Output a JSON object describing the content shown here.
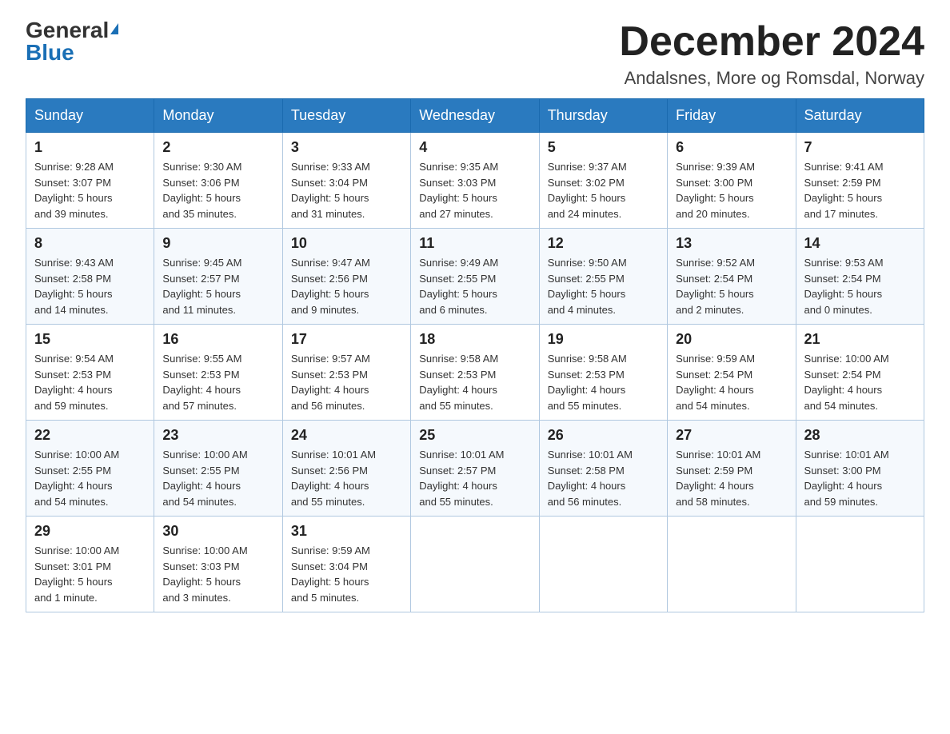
{
  "header": {
    "logo_line1": "General",
    "logo_line2": "Blue",
    "month_title": "December 2024",
    "location": "Andalsnes, More og Romsdal, Norway"
  },
  "weekdays": [
    "Sunday",
    "Monday",
    "Tuesday",
    "Wednesday",
    "Thursday",
    "Friday",
    "Saturday"
  ],
  "weeks": [
    [
      {
        "day": "1",
        "sunrise": "9:28 AM",
        "sunset": "3:07 PM",
        "daylight": "5 hours and 39 minutes."
      },
      {
        "day": "2",
        "sunrise": "9:30 AM",
        "sunset": "3:06 PM",
        "daylight": "5 hours and 35 minutes."
      },
      {
        "day": "3",
        "sunrise": "9:33 AM",
        "sunset": "3:04 PM",
        "daylight": "5 hours and 31 minutes."
      },
      {
        "day": "4",
        "sunrise": "9:35 AM",
        "sunset": "3:03 PM",
        "daylight": "5 hours and 27 minutes."
      },
      {
        "day": "5",
        "sunrise": "9:37 AM",
        "sunset": "3:02 PM",
        "daylight": "5 hours and 24 minutes."
      },
      {
        "day": "6",
        "sunrise": "9:39 AM",
        "sunset": "3:00 PM",
        "daylight": "5 hours and 20 minutes."
      },
      {
        "day": "7",
        "sunrise": "9:41 AM",
        "sunset": "2:59 PM",
        "daylight": "5 hours and 17 minutes."
      }
    ],
    [
      {
        "day": "8",
        "sunrise": "9:43 AM",
        "sunset": "2:58 PM",
        "daylight": "5 hours and 14 minutes."
      },
      {
        "day": "9",
        "sunrise": "9:45 AM",
        "sunset": "2:57 PM",
        "daylight": "5 hours and 11 minutes."
      },
      {
        "day": "10",
        "sunrise": "9:47 AM",
        "sunset": "2:56 PM",
        "daylight": "5 hours and 9 minutes."
      },
      {
        "day": "11",
        "sunrise": "9:49 AM",
        "sunset": "2:55 PM",
        "daylight": "5 hours and 6 minutes."
      },
      {
        "day": "12",
        "sunrise": "9:50 AM",
        "sunset": "2:55 PM",
        "daylight": "5 hours and 4 minutes."
      },
      {
        "day": "13",
        "sunrise": "9:52 AM",
        "sunset": "2:54 PM",
        "daylight": "5 hours and 2 minutes."
      },
      {
        "day": "14",
        "sunrise": "9:53 AM",
        "sunset": "2:54 PM",
        "daylight": "5 hours and 0 minutes."
      }
    ],
    [
      {
        "day": "15",
        "sunrise": "9:54 AM",
        "sunset": "2:53 PM",
        "daylight": "4 hours and 59 minutes."
      },
      {
        "day": "16",
        "sunrise": "9:55 AM",
        "sunset": "2:53 PM",
        "daylight": "4 hours and 57 minutes."
      },
      {
        "day": "17",
        "sunrise": "9:57 AM",
        "sunset": "2:53 PM",
        "daylight": "4 hours and 56 minutes."
      },
      {
        "day": "18",
        "sunrise": "9:58 AM",
        "sunset": "2:53 PM",
        "daylight": "4 hours and 55 minutes."
      },
      {
        "day": "19",
        "sunrise": "9:58 AM",
        "sunset": "2:53 PM",
        "daylight": "4 hours and 55 minutes."
      },
      {
        "day": "20",
        "sunrise": "9:59 AM",
        "sunset": "2:54 PM",
        "daylight": "4 hours and 54 minutes."
      },
      {
        "day": "21",
        "sunrise": "10:00 AM",
        "sunset": "2:54 PM",
        "daylight": "4 hours and 54 minutes."
      }
    ],
    [
      {
        "day": "22",
        "sunrise": "10:00 AM",
        "sunset": "2:55 PM",
        "daylight": "4 hours and 54 minutes."
      },
      {
        "day": "23",
        "sunrise": "10:00 AM",
        "sunset": "2:55 PM",
        "daylight": "4 hours and 54 minutes."
      },
      {
        "day": "24",
        "sunrise": "10:01 AM",
        "sunset": "2:56 PM",
        "daylight": "4 hours and 55 minutes."
      },
      {
        "day": "25",
        "sunrise": "10:01 AM",
        "sunset": "2:57 PM",
        "daylight": "4 hours and 55 minutes."
      },
      {
        "day": "26",
        "sunrise": "10:01 AM",
        "sunset": "2:58 PM",
        "daylight": "4 hours and 56 minutes."
      },
      {
        "day": "27",
        "sunrise": "10:01 AM",
        "sunset": "2:59 PM",
        "daylight": "4 hours and 58 minutes."
      },
      {
        "day": "28",
        "sunrise": "10:01 AM",
        "sunset": "3:00 PM",
        "daylight": "4 hours and 59 minutes."
      }
    ],
    [
      {
        "day": "29",
        "sunrise": "10:00 AM",
        "sunset": "3:01 PM",
        "daylight": "5 hours and 1 minute."
      },
      {
        "day": "30",
        "sunrise": "10:00 AM",
        "sunset": "3:03 PM",
        "daylight": "5 hours and 3 minutes."
      },
      {
        "day": "31",
        "sunrise": "9:59 AM",
        "sunset": "3:04 PM",
        "daylight": "5 hours and 5 minutes."
      },
      null,
      null,
      null,
      null
    ]
  ],
  "labels": {
    "sunrise": "Sunrise:",
    "sunset": "Sunset:",
    "daylight": "Daylight:"
  }
}
